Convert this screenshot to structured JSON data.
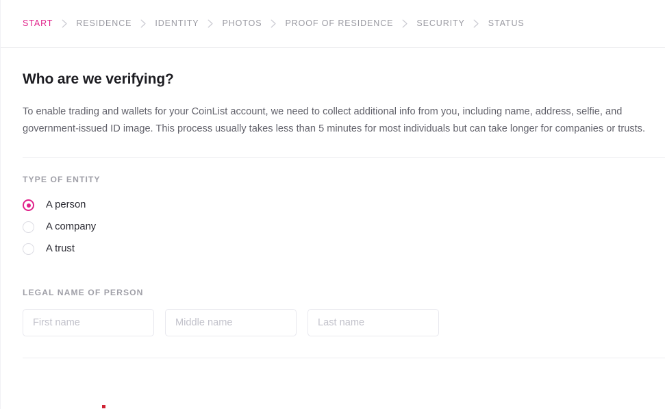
{
  "theme": {
    "accent": "#e0218a",
    "text_primary": "#1c1c21",
    "text_body": "#62626b",
    "text_muted": "#9a9aa2",
    "rule": "#ededf0",
    "marker": "#cf2233"
  },
  "stepbar": {
    "steps": [
      {
        "label": "START",
        "active": true
      },
      {
        "label": "RESIDENCE",
        "active": false
      },
      {
        "label": "IDENTITY",
        "active": false
      },
      {
        "label": "PHOTOS",
        "active": false
      },
      {
        "label": "PROOF OF RESIDENCE",
        "active": false
      },
      {
        "label": "SECURITY",
        "active": false
      },
      {
        "label": "STATUS",
        "active": false
      }
    ],
    "separator_icon": "chevron-right-icon"
  },
  "main": {
    "title": "Who are we verifying?",
    "description": "To enable trading and wallets for your CoinList account, we need to collect additional info from you, including name, address, selfie, and government-issued ID image. This process usually takes less than 5 minutes for most individuals but can take longer for companies or trusts.",
    "entity": {
      "label": "TYPE OF ENTITY",
      "options": [
        {
          "label": "A person",
          "selected": true
        },
        {
          "label": "A company",
          "selected": false
        },
        {
          "label": "A trust",
          "selected": false
        }
      ]
    },
    "legal_name": {
      "label": "LEGAL NAME OF PERSON",
      "fields": [
        {
          "name": "first",
          "value": "",
          "placeholder": "First name"
        },
        {
          "name": "middle",
          "value": "",
          "placeholder": "Middle name"
        },
        {
          "name": "last",
          "value": "",
          "placeholder": "Last name"
        }
      ]
    }
  }
}
